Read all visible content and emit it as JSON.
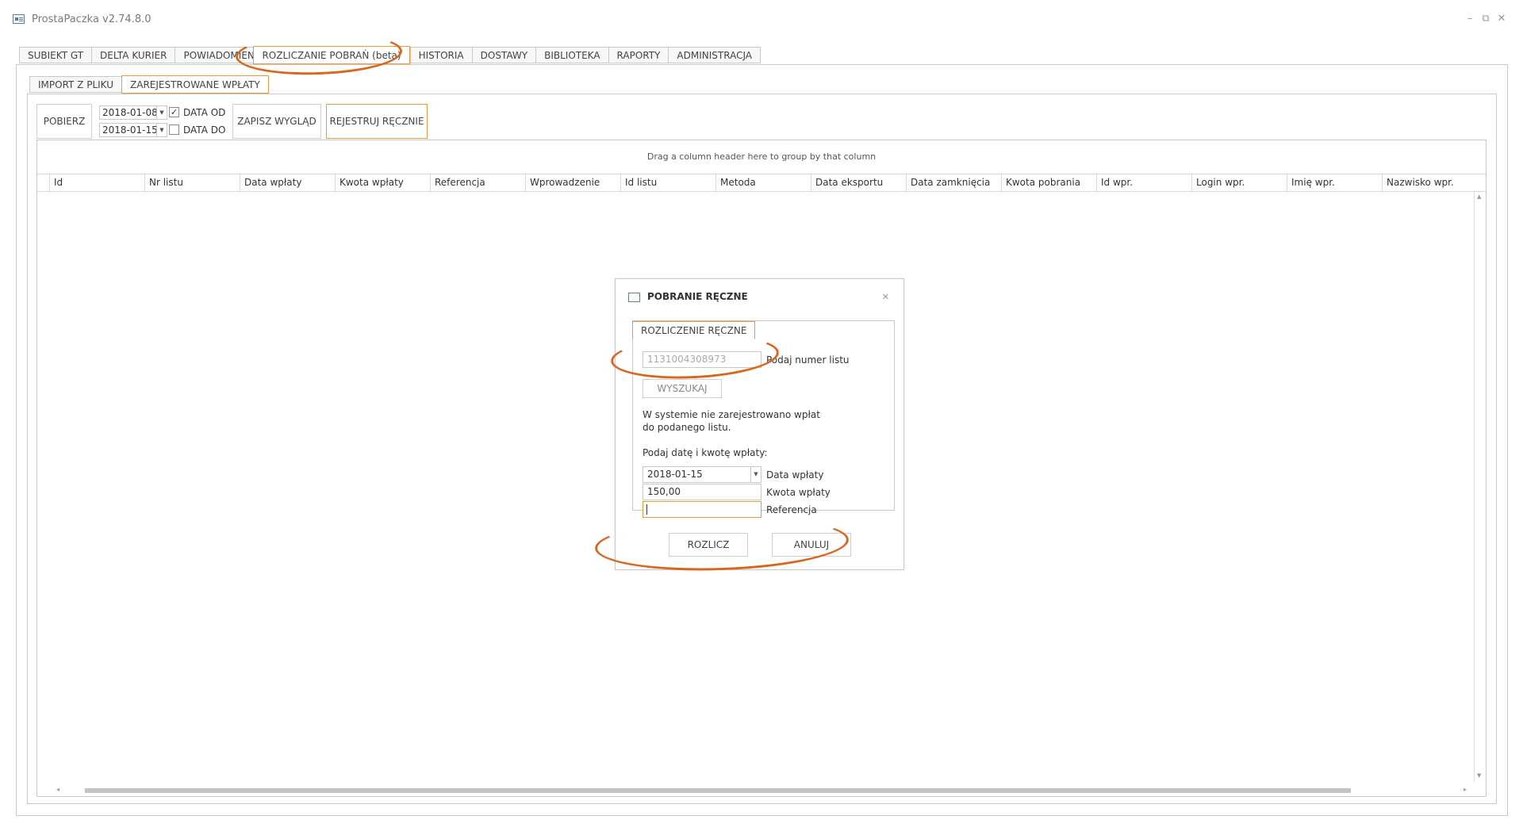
{
  "app": {
    "title": "ProstaPaczka v2.74.8.0",
    "min": "–",
    "restore": "⧉",
    "close": "✕"
  },
  "main_tabs": [
    "SUBIEKT GT",
    "DELTA KURIER",
    "POWIADOMIENIA",
    "ROZLICZANIE POBRAŃ (beta)",
    "HISTORIA",
    "DOSTAWY",
    "BIBLIOTEKA",
    "RAPORTY",
    "ADMINISTRACJA"
  ],
  "sub_tabs": [
    "IMPORT Z PLIKU",
    "ZAREJESTROWANE WPŁATY"
  ],
  "toolbar": {
    "pobierz": "POBIERZ",
    "date_from": "2018-01-08",
    "date_to": "2018-01-15",
    "data_od_label": "DATA OD",
    "data_do_label": "DATA DO",
    "data_od_checked": "✓",
    "data_do_checked": "",
    "zapisz": "ZAPISZ WYGLĄD",
    "rejestruj": "REJESTRUJ RĘCZNIE"
  },
  "grid": {
    "group_hint": "Drag a column header here to group by that column",
    "columns": [
      "Id",
      "Nr listu",
      "Data wpłaty",
      "Kwota wpłaty",
      "Referencja",
      "Wprowadzenie",
      "Id listu",
      "Metoda",
      "Data eksportu",
      "Data zamknięcia",
      "Kwota pobrania",
      "Id wpr.",
      "Login wpr.",
      "Imię wpr.",
      "Nazwisko wpr."
    ]
  },
  "dialog": {
    "title": "POBRANIE RĘCZNE",
    "tab": "ROZLICZENIE RĘCZNE",
    "numer_placeholder": "1131004308973",
    "numer_label": "Podaj numer listu",
    "wyszukaj": "WYSZUKAJ",
    "message_line1": "W systemie nie zarejestrowano wpłat",
    "message_line2": "do podanego listu.",
    "prompt": "Podaj datę i kwotę wpłaty:",
    "data_value": "2018-01-15",
    "data_label": "Data wpłaty",
    "kwota_value": "150,00",
    "kwota_label": "Kwota wpłaty",
    "referencja_value": "",
    "referencja_label": "Referencja",
    "rozlicz": "ROZLICZ",
    "anuluj": "ANULUJ",
    "close": "✕"
  },
  "colors": {
    "accent": "#e89a3c",
    "annotation": "#d8661e",
    "border": "#c8c8c8"
  }
}
